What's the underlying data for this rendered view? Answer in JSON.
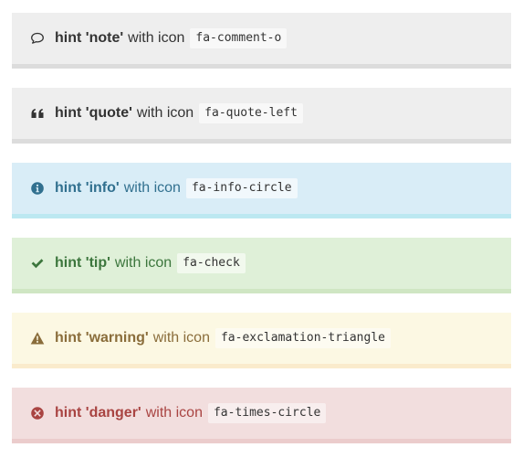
{
  "hints": [
    {
      "title": "hint 'note'",
      "mid": "with icon",
      "code": "fa-comment-o",
      "icon": "comment-o-icon",
      "color": "#333333",
      "bg": "#eeeeee"
    },
    {
      "title": "hint 'quote'",
      "mid": "with icon",
      "code": "fa-quote-left",
      "icon": "quote-left-icon",
      "color": "#333333",
      "bg": "#eeeeee"
    },
    {
      "title": "hint 'info'",
      "mid": "with icon",
      "code": "fa-info-circle",
      "icon": "info-circle-icon",
      "color": "#31708f",
      "bg": "#d9edf7"
    },
    {
      "title": "hint 'tip'",
      "mid": "with icon",
      "code": "fa-check",
      "icon": "check-icon",
      "color": "#3c763d",
      "bg": "#dff0d8"
    },
    {
      "title": "hint 'warning'",
      "mid": "with icon",
      "code": "fa-exclamation-triangle",
      "icon": "exclamation-triangle-icon",
      "color": "#8a6d3b",
      "bg": "#fcf8e3"
    },
    {
      "title": "hint 'danger'",
      "mid": "with icon",
      "code": "fa-times-circle",
      "icon": "times-circle-icon",
      "color": "#a94442",
      "bg": "#f2dede"
    }
  ]
}
